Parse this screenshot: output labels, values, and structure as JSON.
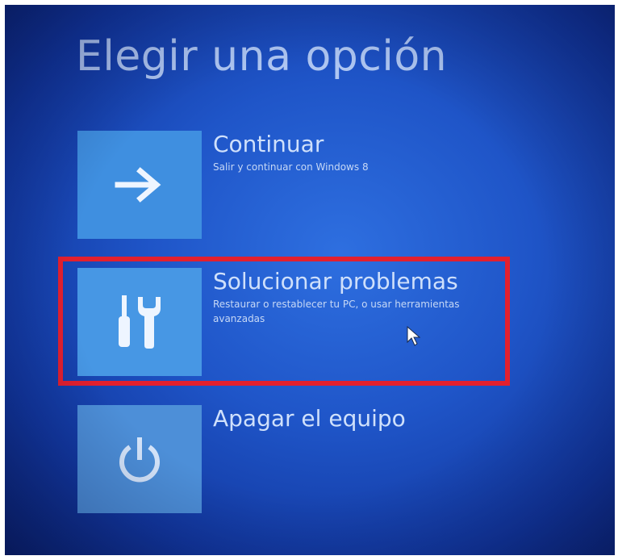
{
  "screen": {
    "title": "Elegir una opción"
  },
  "options": [
    {
      "title": "Continuar",
      "subtitle": "Salir y continuar con Windows 8",
      "icon": "arrow-right-icon"
    },
    {
      "title": "Solucionar problemas",
      "subtitle": "Restaurar o restablecer tu PC, o usar herramientas avanzadas",
      "icon": "tools-icon",
      "highlighted": true
    },
    {
      "title": "Apagar el equipo",
      "subtitle": "",
      "icon": "power-icon"
    }
  ],
  "colors": {
    "background": "#1f55c8",
    "tile": "#3f8fe0",
    "text": "#cfe0fb",
    "highlight": "#e3202e"
  }
}
